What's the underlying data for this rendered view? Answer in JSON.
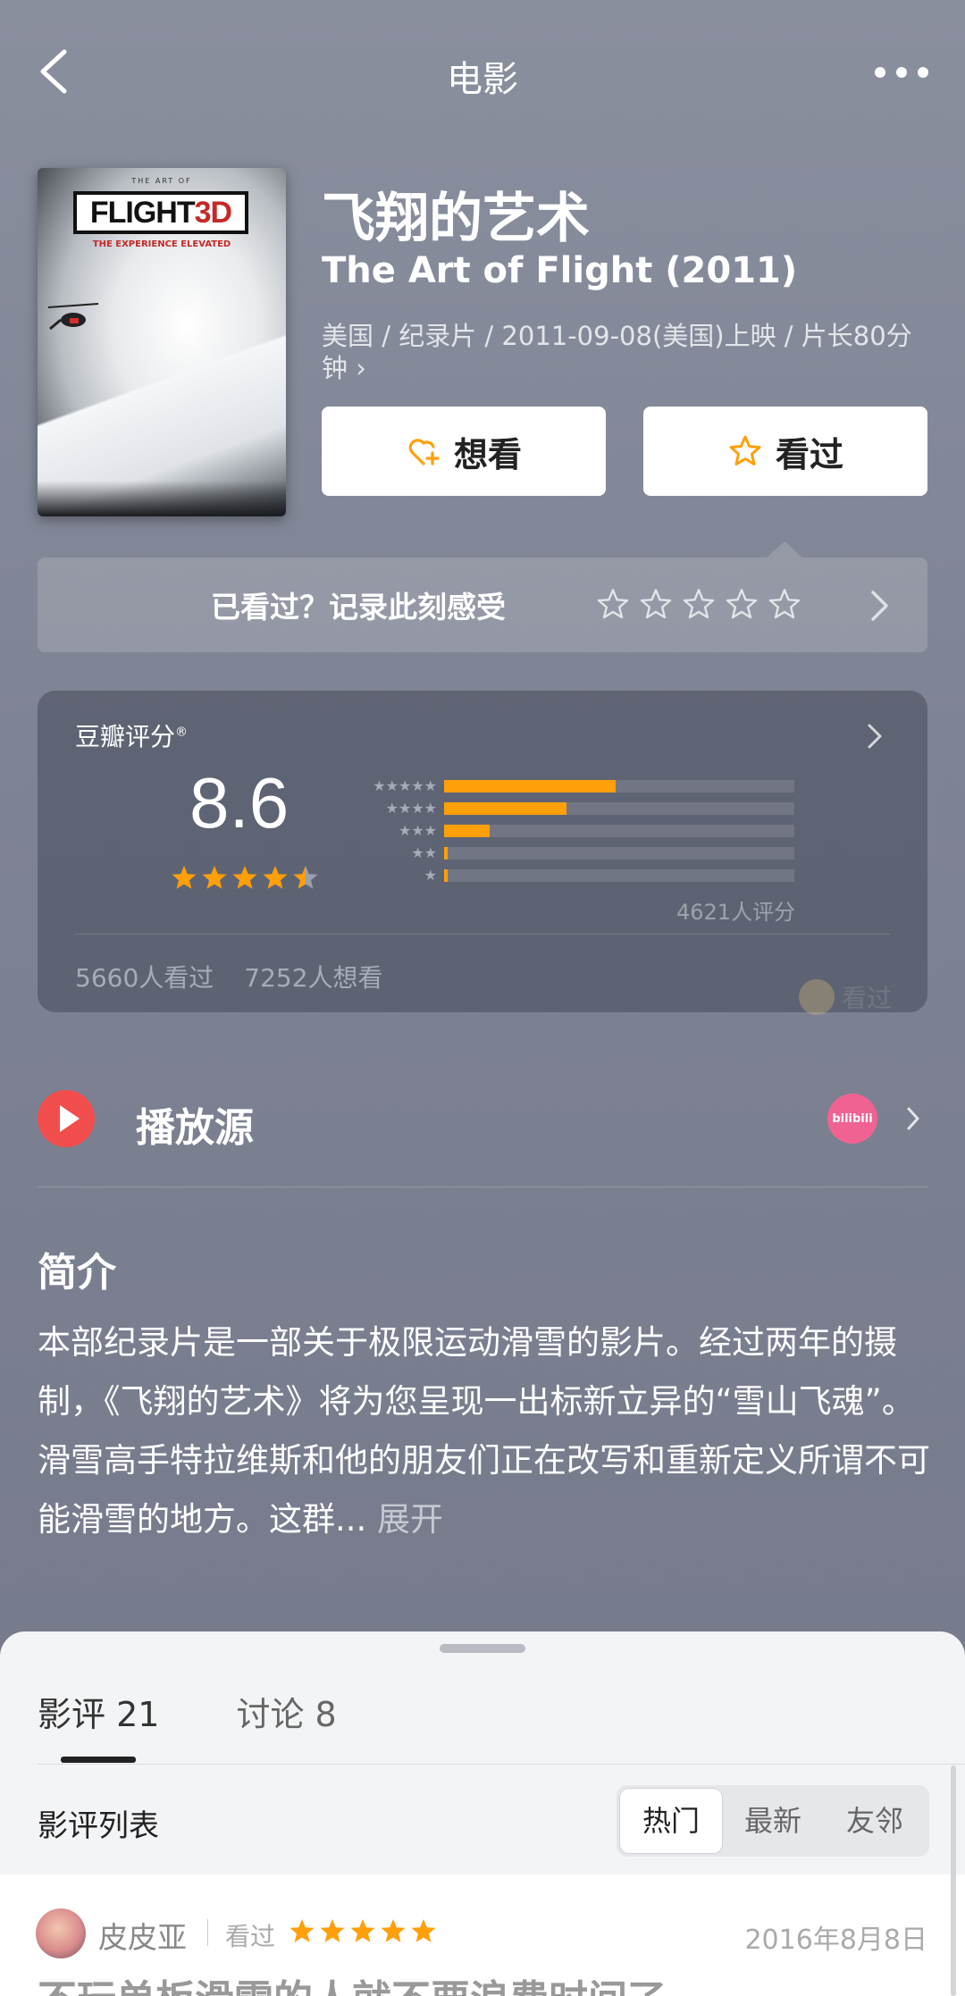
{
  "header": {
    "title": "电影",
    "back_icon": "chevron-left-icon",
    "more_icon": "more-dots-icon"
  },
  "movie": {
    "title_cn": "飞翔的艺术",
    "title_en": "The Art of Flight (2011)",
    "meta": "美国 / 纪录片 / 2011-09-08(美国)上映 / 片长80分钟 ›",
    "poster": {
      "top_text": "THE ART OF",
      "logo_text": "FLIGHT",
      "logo_suffix": "3D",
      "tagline": "THE EXPERIENCE ELEVATED"
    }
  },
  "actions": {
    "want_label": "想看",
    "seen_label": "看过"
  },
  "record": {
    "text": "已看过？记录此刻感受",
    "star_count": 5
  },
  "rating": {
    "label": "豆瓣评分",
    "mark": "®",
    "score": "8.6",
    "stars_value": 4.5,
    "distribution": [
      {
        "stars": "★★★★★",
        "percent": 49
      },
      {
        "stars": "★★★★",
        "percent": 35
      },
      {
        "stars": "★★★",
        "percent": 13
      },
      {
        "stars": "★★",
        "percent": 1
      },
      {
        "stars": "★",
        "percent": 1
      }
    ],
    "count_text": "4621人评分",
    "seen_count": "5660人看过",
    "want_count": "7252人想看",
    "watermark": "看过"
  },
  "play": {
    "label": "播放源",
    "provider": "bilibili"
  },
  "intro": {
    "title": "简介",
    "body": "本部纪录片是一部关于极限运动滑雪的影片。经过两年的摄制，《飞翔的艺术》将为您呈现一出标新立异的“雪山飞魂”。 滑雪高手特拉维斯和他的朋友们正在改写和重新定义所谓不可能滑雪的地方。这群... ",
    "more": "展开"
  },
  "sheet": {
    "tabs": [
      {
        "label": "影评 21",
        "active": true
      },
      {
        "label": "讨论 8",
        "active": false
      }
    ],
    "list_title": "影评列表",
    "sort_options": [
      {
        "label": "热门",
        "active": true
      },
      {
        "label": "最新",
        "active": false
      },
      {
        "label": "友邻",
        "active": false
      }
    ],
    "review": {
      "author": "皮皮亚",
      "status": "看过",
      "stars": 5,
      "date": "2016年8月8日",
      "headline": "不玩单板滑雪的人就不要浪费时间了"
    }
  },
  "colors": {
    "accent": "#ff9f0a",
    "play_red": "#f24d4d",
    "bilibili_pink": "#f06292"
  }
}
